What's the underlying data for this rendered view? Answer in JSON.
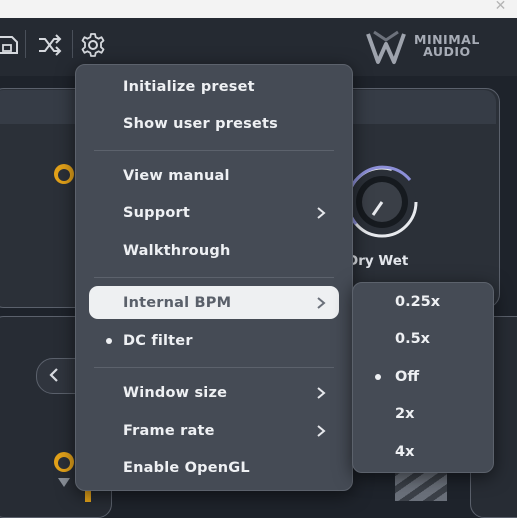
{
  "window": {
    "close_glyph": "✕"
  },
  "toolbar": {
    "icons": [
      "save-icon",
      "shuffle-icon",
      "gear-icon"
    ],
    "logo_line1": "MINIMAL",
    "logo_line2": "AUDIO"
  },
  "knob": {
    "label": "Dry Wet"
  },
  "menu": {
    "items": [
      {
        "label": "Initialize preset"
      },
      {
        "label": "Show user presets"
      },
      {
        "label": "View manual"
      },
      {
        "label": "Support",
        "has_submenu": true
      },
      {
        "label": "Walkthrough"
      },
      {
        "label": "Internal BPM",
        "has_submenu": true,
        "highlighted": true
      },
      {
        "label": "DC filter",
        "checked": true
      },
      {
        "label": "Window size",
        "has_submenu": true
      },
      {
        "label": "Frame rate",
        "has_submenu": true
      },
      {
        "label": "Enable OpenGL"
      }
    ]
  },
  "submenu": {
    "title_of": "Internal BPM",
    "items": [
      {
        "label": "0.25x"
      },
      {
        "label": "0.5x"
      },
      {
        "label": "Off",
        "checked": true
      },
      {
        "label": "2x"
      },
      {
        "label": "4x"
      }
    ]
  },
  "colors": {
    "accent_knob": "#e3a21a",
    "knob_ring": "#8c8fd8",
    "menu_bg": "#454b55",
    "highlight_bg": "#eef0f2"
  }
}
